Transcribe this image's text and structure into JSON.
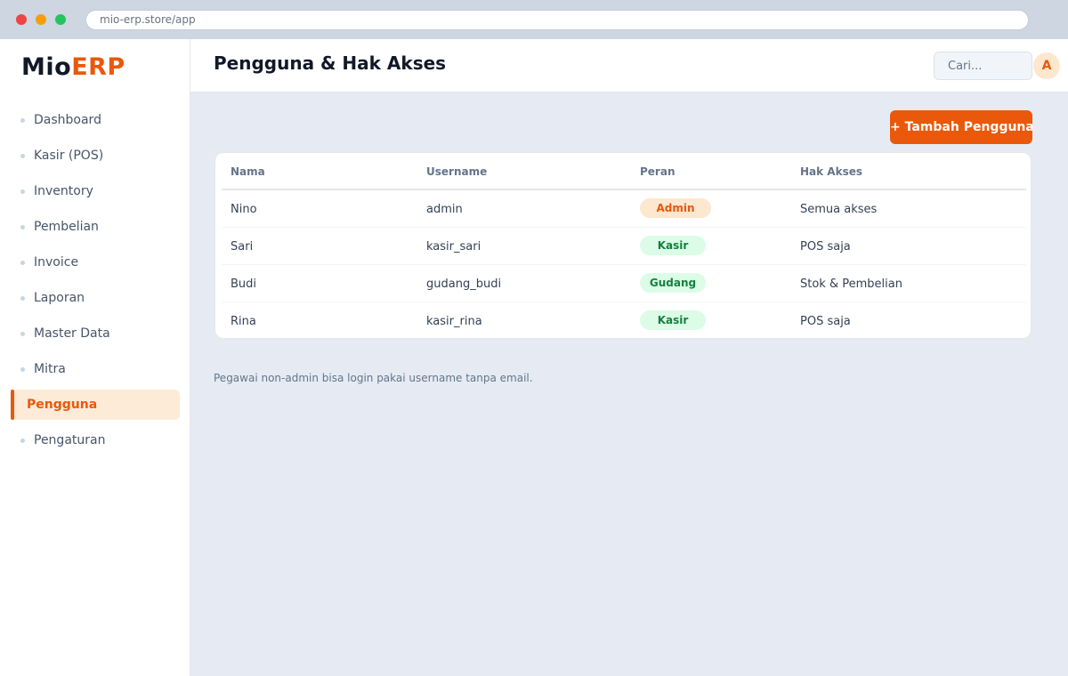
{
  "browser": {
    "url": "mio-erp.store/app"
  },
  "brand": {
    "name_part1": "Mio",
    "name_part2": "ERP",
    "accent_color": "#ea580c"
  },
  "sidebar": {
    "items": [
      {
        "label": "Dashboard"
      },
      {
        "label": "Kasir (POS)"
      },
      {
        "label": "Inventory"
      },
      {
        "label": "Pembelian"
      },
      {
        "label": "Invoice"
      },
      {
        "label": "Laporan"
      },
      {
        "label": "Master Data"
      },
      {
        "label": "Mitra"
      },
      {
        "label": "Pengguna",
        "active": true
      },
      {
        "label": "Pengaturan"
      }
    ]
  },
  "header": {
    "title": "Pengguna & Hak Akses",
    "search_placeholder": "Cari...",
    "avatar_initial": "A"
  },
  "toolbar": {
    "add_button_label": "+ Tambah Pengguna"
  },
  "table": {
    "columns": [
      "Nama",
      "Username",
      "Peran",
      "Hak Akses"
    ],
    "rows": [
      {
        "nama": "Nino",
        "username": "admin",
        "peran": "Admin",
        "hak_akses": "Semua akses"
      },
      {
        "nama": "Sari",
        "username": "kasir_sari",
        "peran": "Kasir",
        "hak_akses": "POS saja"
      },
      {
        "nama": "Budi",
        "username": "gudang_budi",
        "peran": "Gudang",
        "hak_akses": "Stok & Pembelian"
      },
      {
        "nama": "Rina",
        "username": "kasir_rina",
        "peran": "Kasir",
        "hak_akses": "POS saja"
      }
    ]
  },
  "footnote": "Pegawai non-admin bisa login pakai username tanpa email."
}
